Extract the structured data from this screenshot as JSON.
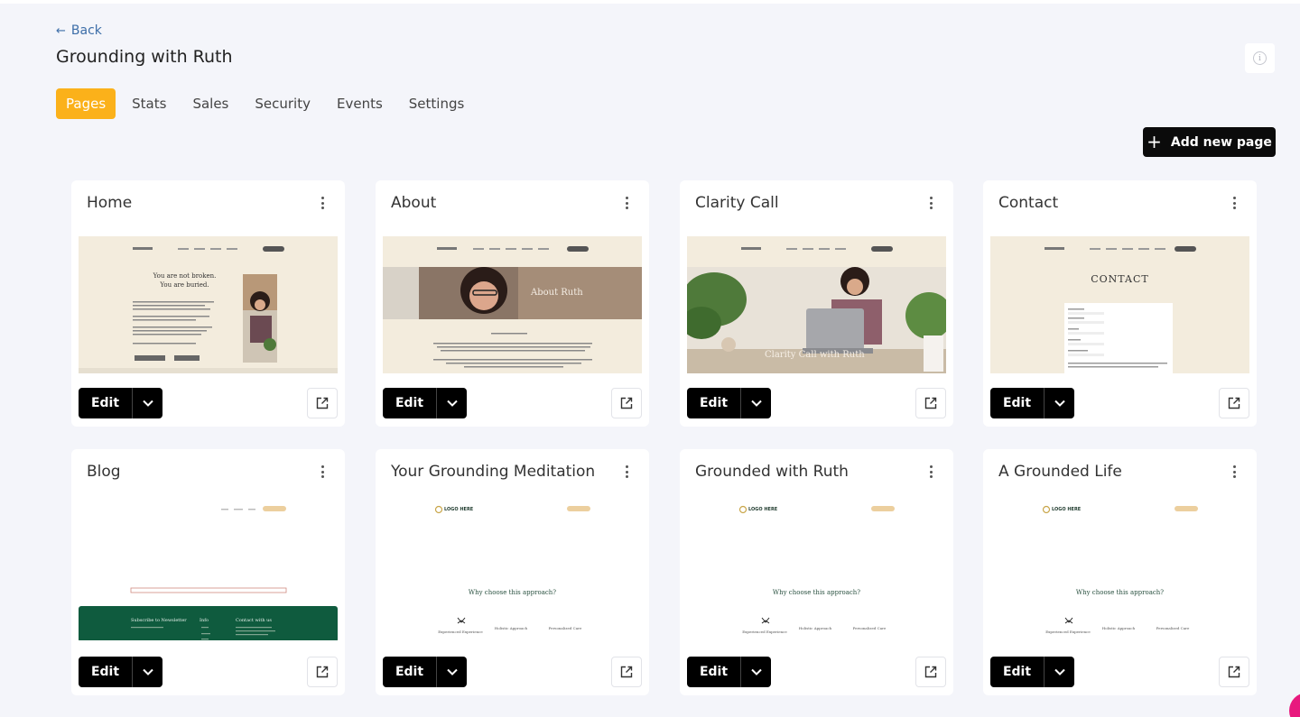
{
  "nav": {
    "back_label": "Back"
  },
  "header": {
    "title": "Grounding with Ruth"
  },
  "tabs": [
    {
      "label": "Pages",
      "active": true
    },
    {
      "label": "Stats",
      "active": false
    },
    {
      "label": "Sales",
      "active": false
    },
    {
      "label": "Security",
      "active": false
    },
    {
      "label": "Events",
      "active": false
    },
    {
      "label": "Settings",
      "active": false
    }
  ],
  "toolbar": {
    "add_page_label": "Add new page"
  },
  "colors": {
    "accent": "#fbb11a",
    "button": "#0b0b0b",
    "link": "#3d6ea8",
    "blog_footer": "#0f5b3e"
  },
  "pages": [
    {
      "title": "Home",
      "edit_label": "Edit",
      "preview": {
        "headline_1": "You are not broken.",
        "headline_2": "You are buried."
      }
    },
    {
      "title": "About",
      "edit_label": "Edit",
      "preview": {
        "banner": "About Ruth"
      }
    },
    {
      "title": "Clarity Call",
      "edit_label": "Edit",
      "preview": {
        "banner": "Clarity Call with Ruth"
      }
    },
    {
      "title": "Contact",
      "edit_label": "Edit",
      "preview": {
        "heading": "CONTACT"
      }
    },
    {
      "title": "Blog",
      "edit_label": "Edit",
      "preview": {
        "footer_col_1": "Subscribe to Newsletter",
        "footer_col_2": "Info",
        "footer_col_3": "Contact with us"
      }
    },
    {
      "title": "Your Grounding Meditation",
      "edit_label": "Edit",
      "preview": {
        "logo": "LOGO HERE",
        "heading": "Why choose this approach?",
        "col_1": "Experienced Experience",
        "col_2": "Holistic Approach",
        "col_3": "Personalized Care"
      }
    },
    {
      "title": "Grounded with Ruth",
      "edit_label": "Edit",
      "preview": {
        "logo": "LOGO HERE",
        "heading": "Why choose this approach?",
        "col_1": "Experienced Experience",
        "col_2": "Holistic Approach",
        "col_3": "Personalized Care"
      }
    },
    {
      "title": "A Grounded Life",
      "edit_label": "Edit",
      "preview": {
        "logo": "LOGO HERE",
        "heading": "Why choose this approach?",
        "col_1": "Experienced Experience",
        "col_2": "Holistic Approach",
        "col_3": "Personalized Care"
      }
    }
  ]
}
